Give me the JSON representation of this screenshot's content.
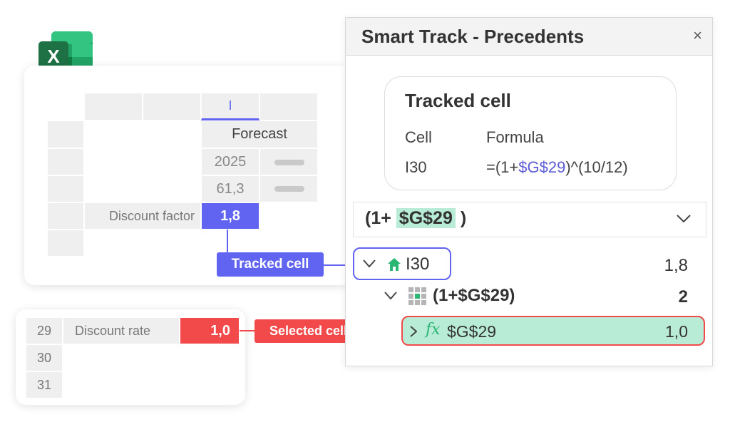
{
  "excel_logo": {
    "letter": "X"
  },
  "sheet_top": {
    "column_letter": "I",
    "forecast_label": "Forecast",
    "year": "2025",
    "value_61": "61,3",
    "discount_factor_label": "Discount factor",
    "tracked_value": "1,8"
  },
  "sheet_bottom": {
    "rows": [
      {
        "num": "29",
        "label": "Discount rate",
        "value": "1,0"
      },
      {
        "num": "30",
        "label": "",
        "value": ""
      },
      {
        "num": "31",
        "label": "",
        "value": ""
      }
    ]
  },
  "callouts": {
    "tracked": "Tracked cell",
    "selected": "Selected cell"
  },
  "panel": {
    "title": "Smart Track - Precedents",
    "close": "×",
    "tracked_card": {
      "heading": "Tracked cell",
      "col_cell": "Cell",
      "col_formula": "Formula",
      "cell": "I30",
      "formula_prefix": "=(1+",
      "formula_ref": "$G$29",
      "formula_suffix": ")^(10/12)"
    },
    "expression": {
      "prefix": "(1+",
      "ref": "$G$29",
      "suffix": ")"
    },
    "tree": [
      {
        "label": "I30",
        "value": "1,8"
      },
      {
        "label": "(1+$G$29)",
        "value": "2"
      },
      {
        "label": "$G$29",
        "value": "1,0"
      }
    ]
  },
  "colors": {
    "accent": "#6164f0",
    "selected": "#f24a4a",
    "highlight": "#b9ecd6",
    "excel_green": "#1e7145"
  }
}
